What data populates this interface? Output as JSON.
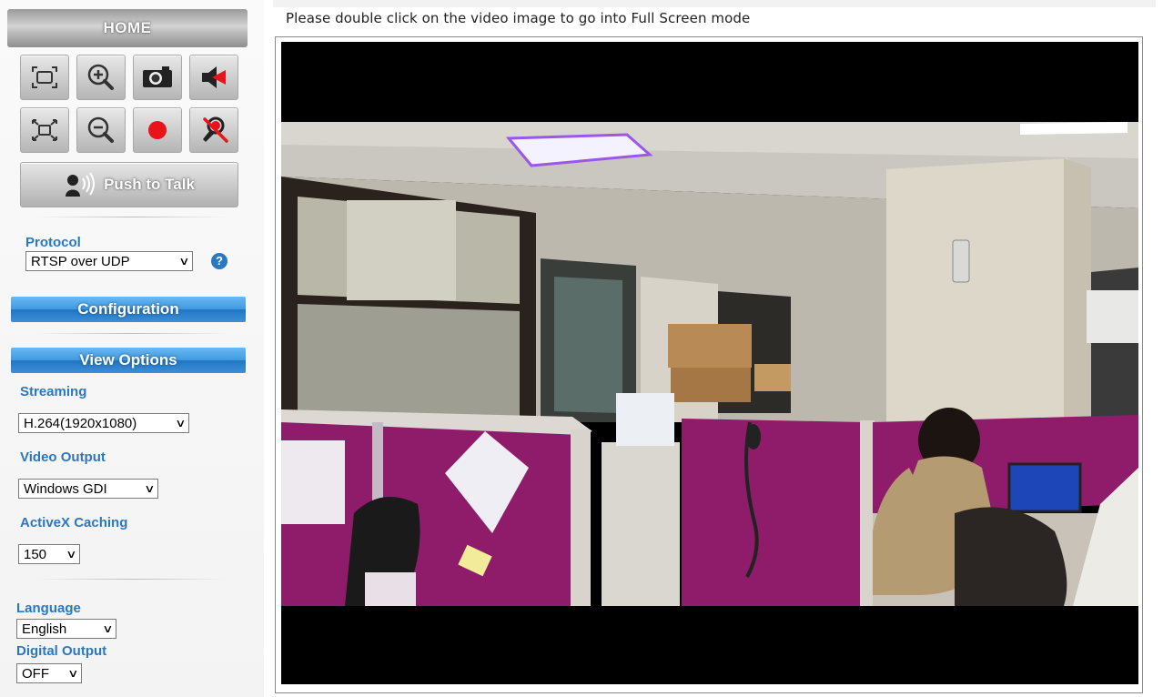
{
  "sidebar": {
    "home_label": "HOME",
    "controls": [
      {
        "name": "fit-screen-icon"
      },
      {
        "name": "zoom-in-icon"
      },
      {
        "name": "snapshot-camera-icon"
      },
      {
        "name": "speaker-icon"
      },
      {
        "name": "full-size-icon"
      },
      {
        "name": "zoom-out-icon"
      },
      {
        "name": "record-icon"
      },
      {
        "name": "microphone-mute-icon"
      }
    ],
    "push_to_talk_label": "Push to Talk",
    "protocol": {
      "label": "Protocol",
      "value": "RTSP over UDP",
      "help_icon": "?"
    },
    "configuration_label": "Configuration",
    "view_options_label": "View Options",
    "streaming": {
      "label": "Streaming",
      "value": "H.264(1920x1080)"
    },
    "video_output": {
      "label": "Video Output",
      "value": "Windows GDI"
    },
    "activex_caching": {
      "label": "ActiveX Caching",
      "value": "150"
    },
    "language": {
      "label": "Language",
      "value": "English"
    },
    "digital_output": {
      "label": "Digital Output",
      "value": "OFF"
    }
  },
  "main": {
    "hint": "Please double click on the video image to go into Full Screen mode"
  },
  "colors": {
    "accent_blue": "#2a78c4",
    "button_blue": "#3f9ae0",
    "record_red": "#e8141b",
    "cubicle_magenta": "#8f1c6a"
  }
}
